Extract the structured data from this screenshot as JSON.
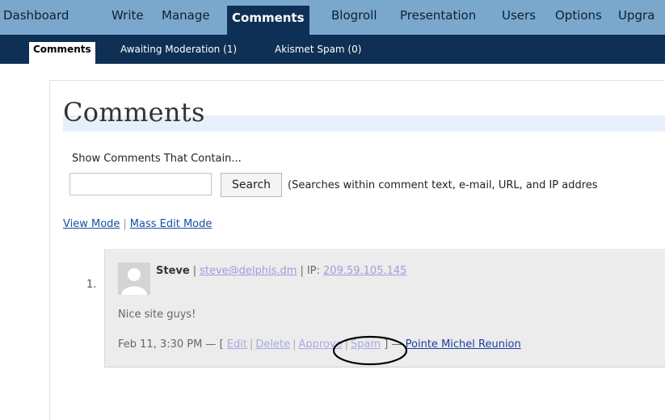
{
  "top_nav": [
    {
      "label": "Dashboard"
    },
    {
      "label": "Write"
    },
    {
      "label": "Manage"
    },
    {
      "label": "Comments",
      "active": true
    },
    {
      "label": "Blogroll"
    },
    {
      "label": "Presentation"
    },
    {
      "label": "Users"
    },
    {
      "label": "Options"
    },
    {
      "label": "Upgra"
    }
  ],
  "sub_nav": [
    {
      "label": "Comments",
      "active": true
    },
    {
      "label": "Awaiting Moderation (1)"
    },
    {
      "label": "Akismet Spam (0)"
    }
  ],
  "page": {
    "title": "Comments",
    "search_label": "Show Comments That Contain...",
    "search_value": "",
    "search_button": "Search",
    "search_hint": "(Searches within comment text, e-mail, URL, and IP addres",
    "view_mode": "View Mode",
    "mass_edit_mode": "Mass Edit Mode",
    "mode_sep": "|"
  },
  "comment": {
    "number": "1.",
    "author": "Steve",
    "email": "steve@delphis.dm",
    "ip_label": "IP:",
    "ip": "209.59.105.145",
    "meta_sep": "|",
    "text": "Nice site guys!",
    "date": "Feb 11, 3:30 PM — [",
    "actions": [
      "Edit",
      "Delete",
      "Approve",
      "Spam"
    ],
    "action_sep": "|",
    "close": "] —",
    "post_title": "Pointe Michel Reunion"
  },
  "colors": {
    "nav_bg": "#7aa8cc",
    "subnav_bg": "#0e3054",
    "annotation": "#000000"
  }
}
